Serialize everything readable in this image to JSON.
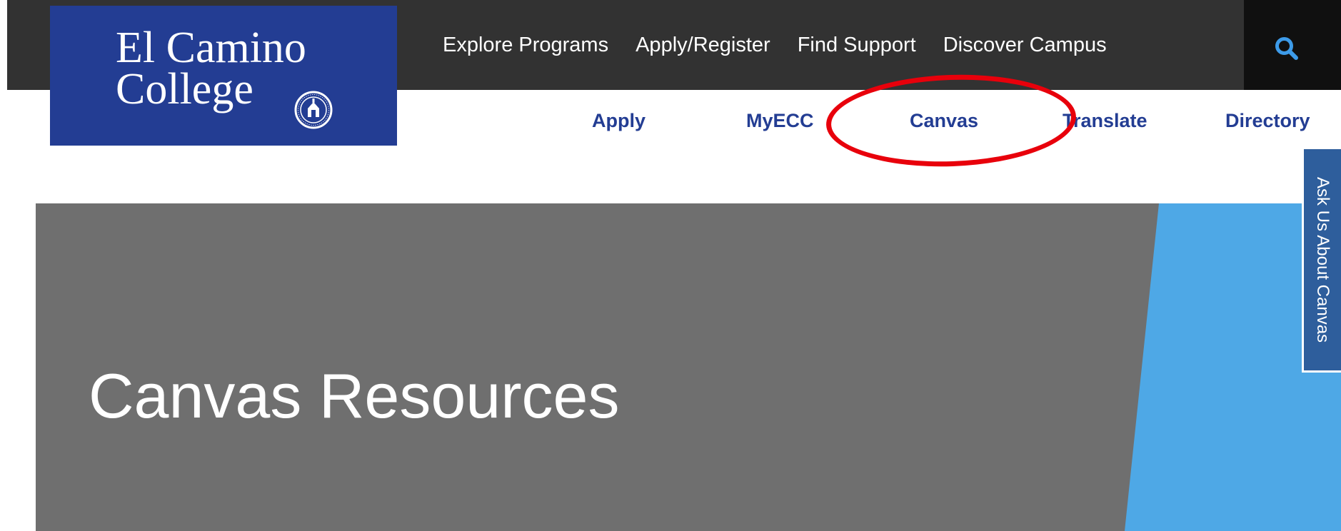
{
  "logo": {
    "line1": "El Camino",
    "line2": "College"
  },
  "top_nav": {
    "items": [
      {
        "label": "Explore Programs"
      },
      {
        "label": "Apply/Register"
      },
      {
        "label": "Find Support"
      },
      {
        "label": "Discover Campus"
      }
    ],
    "search_icon": "search-icon"
  },
  "sub_nav": {
    "items": [
      {
        "label": "Apply"
      },
      {
        "label": "MyECC"
      },
      {
        "label": "Canvas"
      },
      {
        "label": "Translate"
      },
      {
        "label": "Directory"
      }
    ]
  },
  "hero": {
    "title": "Canvas Resources"
  },
  "side_tab": {
    "label": "Ask Us About Canvas"
  },
  "colors": {
    "top_bar": "#323232",
    "search_box": "#101010",
    "brand_blue": "#233d93",
    "hero_gray": "#6f6f6f",
    "hero_accent": "#4ea8e6",
    "side_tab": "#2e5e9c",
    "annotation": "#e8000b"
  }
}
